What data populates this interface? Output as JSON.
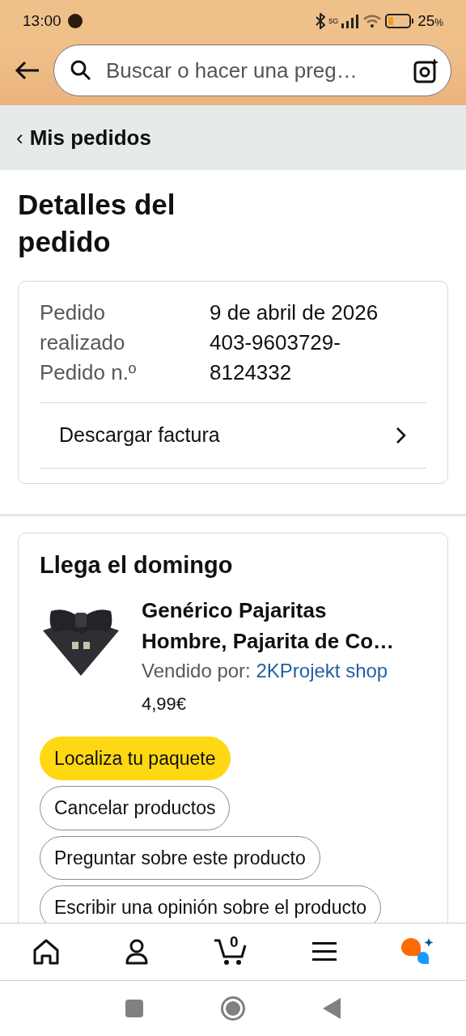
{
  "status_bar": {
    "time": "13:00",
    "battery_text": "25",
    "battery_unit": "%",
    "network": "5G"
  },
  "header": {
    "search": {
      "placeholder": "Buscar o hacer una preg…"
    }
  },
  "breadcrumb": {
    "arrow": "‹",
    "label": "Mis pedidos"
  },
  "page_title": "Detalles del pedido",
  "order_info": {
    "rows": [
      {
        "label": "Pedido realizado",
        "value": "9 de abril de 2026"
      },
      {
        "label": "Pedido n.º",
        "value": "403-9603729-8124332"
      }
    ],
    "link": "Descargar factura"
  },
  "shipment": {
    "heading": "Llega el domingo",
    "product": {
      "kind": "picture",
      "title": "Genérico Pajaritas Hombre, Pajarita de Co…",
      "seller_label": "Vendido por:",
      "seller": "2KProjekt shop",
      "price": "4,99€"
    },
    "buttons": [
      {
        "label": "Localiza tu paquete",
        "kind": "primary"
      },
      {
        "label": "Cancelar productos",
        "kind": "secondary"
      },
      {
        "label": "Preguntar sobre este producto",
        "kind": "secondary"
      },
      {
        "label": "Escribir una opinión sobre el producto",
        "kind": "secondary"
      }
    ]
  },
  "bottom_nav": {
    "cart_count": "0"
  }
}
